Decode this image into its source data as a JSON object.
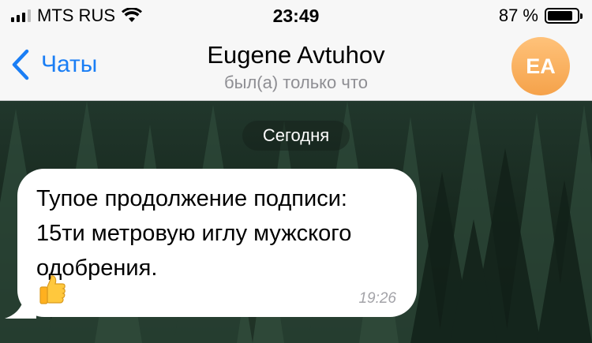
{
  "status_bar": {
    "carrier": "MTS RUS",
    "time": "23:49",
    "battery_percent": "87 %",
    "battery_level": 0.87,
    "signal_bars": 3
  },
  "nav": {
    "back_label": "Чаты",
    "title": "Eugene Avtuhov",
    "subtitle": "был(а) только что",
    "avatar_initials": "EA",
    "accent_color": "#1a7ef5",
    "avatar_color": "#f5a24a"
  },
  "chat": {
    "date_label": "Сегодня",
    "messages": [
      {
        "text": "Тупое продолжение подписи:\n15ти метровую иглу мужского\nодобрения.",
        "emoji": "thumbs-up",
        "time": "19:26"
      }
    ]
  }
}
